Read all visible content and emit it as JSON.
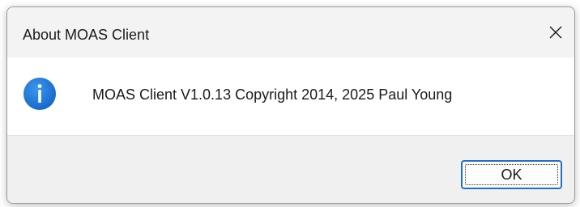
{
  "background": {
    "partial_text": "(blurred text of underlying window)"
  },
  "dialog": {
    "title": "About MOAS Client",
    "close_glyph": "✕",
    "icon": "info-icon",
    "message": "MOAS Client V1.0.13 Copyright 2014, 2025 Paul Young",
    "ok_label": "OK"
  },
  "colors": {
    "accent": "#1f6fc5",
    "info_icon_blue": "#1a73d6",
    "titlebar_bg": "#f3f3f3",
    "footer_bg": "#f0f0f0"
  }
}
